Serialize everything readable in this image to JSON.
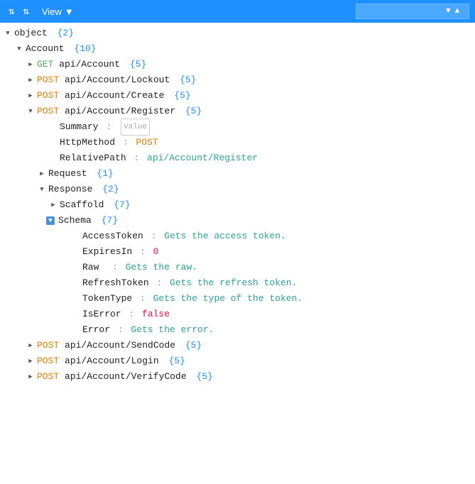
{
  "toolbar": {
    "view_label": "View",
    "dropdown_arrow": "▼",
    "search_placeholder": ""
  },
  "tree": {
    "root_key": "object",
    "root_count": "{2}",
    "nodes": [
      {
        "id": "account",
        "indent": 1,
        "toggle": "expanded",
        "key": "Account",
        "count": "{10}",
        "type": "header"
      },
      {
        "id": "get-account",
        "indent": 2,
        "toggle": "collapsed",
        "key": "GET api/Account",
        "count": "{5}",
        "type": "endpoint",
        "method": "GET"
      },
      {
        "id": "post-lockout",
        "indent": 2,
        "toggle": "collapsed",
        "key": "POST api/Account/Lockout",
        "count": "{5}",
        "type": "endpoint",
        "method": "POST"
      },
      {
        "id": "post-create",
        "indent": 2,
        "toggle": "collapsed",
        "key": "POST api/Account/Create",
        "count": "{5}",
        "type": "endpoint",
        "method": "POST"
      },
      {
        "id": "post-register",
        "indent": 2,
        "toggle": "expanded",
        "key": "POST api/Account/Register",
        "count": "{5}",
        "type": "endpoint",
        "method": "POST"
      },
      {
        "id": "summary",
        "indent": 3,
        "toggle": "none",
        "key": "Summary",
        "separator": ":",
        "value": "value",
        "type": "summary"
      },
      {
        "id": "httpmethod",
        "indent": 3,
        "toggle": "none",
        "key": "HttpMethod",
        "separator": ":",
        "value": "POST",
        "type": "kv-post"
      },
      {
        "id": "relativepath",
        "indent": 3,
        "toggle": "none",
        "key": "RelativePath",
        "separator": ":",
        "value": "api/Account/Register",
        "type": "kv-path"
      },
      {
        "id": "request",
        "indent": 3,
        "toggle": "collapsed",
        "key": "Request",
        "count": "{1}",
        "type": "header"
      },
      {
        "id": "response",
        "indent": 3,
        "toggle": "expanded",
        "key": "Response",
        "count": "{2}",
        "type": "header"
      },
      {
        "id": "scaffold",
        "indent": 4,
        "toggle": "collapsed",
        "key": "Scaffold",
        "count": "{7}",
        "type": "header"
      },
      {
        "id": "schema",
        "indent": 4,
        "toggle": "expanded",
        "key": "Schema",
        "count": "{7}",
        "type": "header"
      },
      {
        "id": "accesstoken",
        "indent": 5,
        "toggle": "none",
        "key": "AccessToken",
        "separator": ":",
        "value": "Gets the access token.",
        "type": "kv-green"
      },
      {
        "id": "expiresin",
        "indent": 5,
        "toggle": "none",
        "key": "ExpiresIn",
        "separator": ":",
        "value": "0",
        "type": "kv-number"
      },
      {
        "id": "raw",
        "indent": 5,
        "toggle": "none",
        "key": "Raw",
        "separator": ":",
        "value": "Gets the raw.",
        "type": "kv-green",
        "extra_space": true
      },
      {
        "id": "refreshtoken",
        "indent": 5,
        "toggle": "none",
        "key": "RefreshToken",
        "separator": ":",
        "value": "Gets the refresh token.",
        "type": "kv-green"
      },
      {
        "id": "tokentype",
        "indent": 5,
        "toggle": "none",
        "key": "TokenType",
        "separator": ":",
        "value": "Gets the type of the token.",
        "type": "kv-green"
      },
      {
        "id": "iserror",
        "indent": 5,
        "toggle": "none",
        "key": "IsError",
        "separator": ":",
        "value": "false",
        "type": "kv-bool-false"
      },
      {
        "id": "error",
        "indent": 5,
        "toggle": "none",
        "key": "Error",
        "separator": ":",
        "value": "Gets the error.",
        "type": "kv-green"
      },
      {
        "id": "post-sendcode",
        "indent": 2,
        "toggle": "collapsed",
        "key": "POST api/Account/SendCode",
        "count": "{5}",
        "type": "endpoint",
        "method": "POST"
      },
      {
        "id": "post-login",
        "indent": 2,
        "toggle": "collapsed",
        "key": "POST api/Account/Login",
        "count": "{5}",
        "type": "endpoint",
        "method": "POST"
      },
      {
        "id": "post-verifycode",
        "indent": 2,
        "toggle": "collapsed",
        "key": "POST api/Account/VerifyCode",
        "count": "{5}",
        "type": "endpoint",
        "method": "POST"
      }
    ]
  }
}
